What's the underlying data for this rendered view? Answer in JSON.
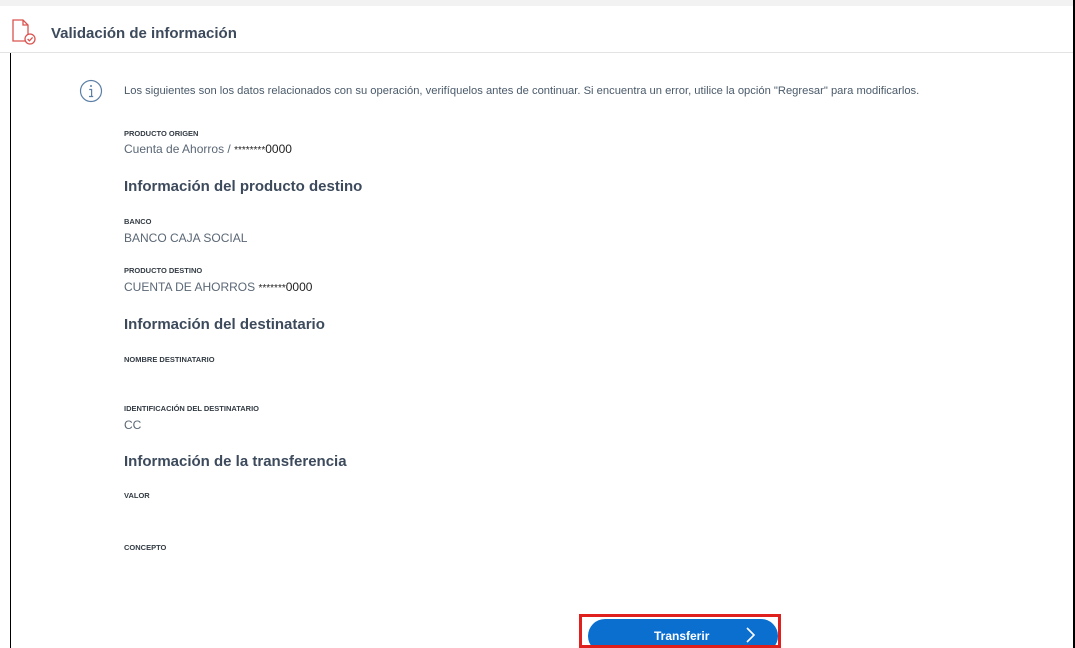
{
  "header": {
    "title": "Validación de información",
    "icon": "document-check-icon"
  },
  "notice": {
    "icon": "info-icon",
    "text": "Los siguientes son los datos relacionados con su operación, verifíquelos antes de continuar. Si encuentra un error, utilice la opción \"Regresar\" para modificarlos."
  },
  "origin": {
    "label": "PRODUCTO ORIGEN",
    "account_type": "Cuenta de Ahorros /",
    "masked": "********",
    "last_digits": "0000"
  },
  "destination_section": {
    "title": "Información del producto destino",
    "bank_label": "BANCO",
    "bank_value": "BANCO CAJA SOCIAL",
    "product_label": "PRODUCTO DESTINO",
    "product_type": "CUENTA DE AHORROS",
    "product_masked": "*******",
    "product_last_digits": "0000"
  },
  "recipient_section": {
    "title": "Información del destinatario",
    "name_label": "NOMBRE DESTINATARIO",
    "name_value": "",
    "id_label": "IDENTIFICACIÓN DEL DESTINATARIO",
    "id_value": "CC"
  },
  "transfer_section": {
    "title": "Información de la transferencia",
    "amount_label": "VALOR",
    "amount_value": "",
    "concept_label": "CONCEPTO",
    "concept_value": ""
  },
  "actions": {
    "transfer_label": "Transferir",
    "transfer_icon": "chevron-right-icon"
  },
  "colors": {
    "primary_button": "#0b6fd0",
    "highlight_border": "#e0201d",
    "header_icon": "#d9534f",
    "info_icon": "#5b7fa6",
    "title_text": "#3c4a5c"
  }
}
